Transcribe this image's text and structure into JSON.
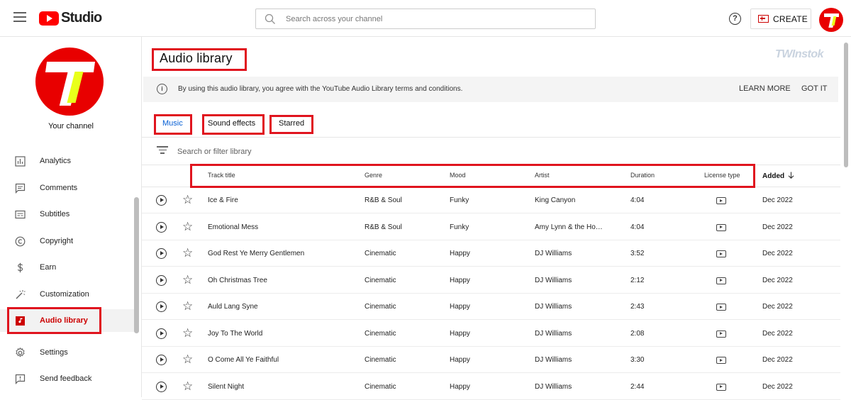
{
  "header": {
    "logo_text": "Studio",
    "search_placeholder": "Search across your channel",
    "help_glyph": "?",
    "create_label": "CREATE"
  },
  "sidebar": {
    "channel_label": "Your channel",
    "items": [
      {
        "label": "Analytics",
        "icon": "analytics-icon"
      },
      {
        "label": "Comments",
        "icon": "comments-icon"
      },
      {
        "label": "Subtitles",
        "icon": "subtitles-icon"
      },
      {
        "label": "Copyright",
        "icon": "copyright-icon"
      },
      {
        "label": "Earn",
        "icon": "dollar-icon"
      },
      {
        "label": "Customization",
        "icon": "magic-wand-icon"
      },
      {
        "label": "Audio library",
        "icon": "audio-library-icon",
        "active": true
      },
      {
        "label": "Settings",
        "icon": "gear-icon"
      },
      {
        "label": "Send feedback",
        "icon": "feedback-icon"
      }
    ]
  },
  "main": {
    "title": "Audio library",
    "watermark": "TWInstok",
    "banner": {
      "info_glyph": "i",
      "message": "By using this audio library, you agree with the YouTube Audio Library terms and conditions.",
      "learn_more": "LEARN MORE",
      "got_it": "GOT IT"
    },
    "tabs": [
      {
        "label": "Music",
        "active": true
      },
      {
        "label": "Sound effects"
      },
      {
        "label": "Starred"
      }
    ],
    "filter_placeholder": "Search or filter library",
    "columns": {
      "track_title": "Track title",
      "genre": "Genre",
      "mood": "Mood",
      "artist": "Artist",
      "duration": "Duration",
      "license_type": "License type",
      "added": "Added"
    },
    "tracks": [
      {
        "title": "Ice & Fire",
        "genre": "R&B & Soul",
        "mood": "Funky",
        "artist": "King Canyon",
        "duration": "4:04",
        "added": "Dec 2022"
      },
      {
        "title": "Emotional Mess",
        "genre": "R&B & Soul",
        "mood": "Funky",
        "artist": "Amy Lynn & the Ho…",
        "duration": "4:04",
        "added": "Dec 2022"
      },
      {
        "title": "God Rest Ye Merry Gentlemen",
        "genre": "Cinematic",
        "mood": "Happy",
        "artist": "DJ Williams",
        "duration": "3:52",
        "added": "Dec 2022"
      },
      {
        "title": "Oh Christmas Tree",
        "genre": "Cinematic",
        "mood": "Happy",
        "artist": "DJ Williams",
        "duration": "2:12",
        "added": "Dec 2022"
      },
      {
        "title": "Auld Lang Syne",
        "genre": "Cinematic",
        "mood": "Happy",
        "artist": "DJ Williams",
        "duration": "2:43",
        "added": "Dec 2022"
      },
      {
        "title": "Joy To The World",
        "genre": "Cinematic",
        "mood": "Happy",
        "artist": "DJ Williams",
        "duration": "2:08",
        "added": "Dec 2022"
      },
      {
        "title": "O Come All Ye Faithful",
        "genre": "Cinematic",
        "mood": "Happy",
        "artist": "DJ Williams",
        "duration": "3:30",
        "added": "Dec 2022"
      },
      {
        "title": "Silent Night",
        "genre": "Cinematic",
        "mood": "Happy",
        "artist": "DJ Williams",
        "duration": "2:44",
        "added": "Dec 2022"
      }
    ]
  },
  "colors": {
    "brand_red": "#ff0000",
    "highlight_red": "#e0141e",
    "tab_blue": "#065fd4",
    "avatar_red": "#e80000",
    "avatar_yellow": "#e9ff1a"
  }
}
